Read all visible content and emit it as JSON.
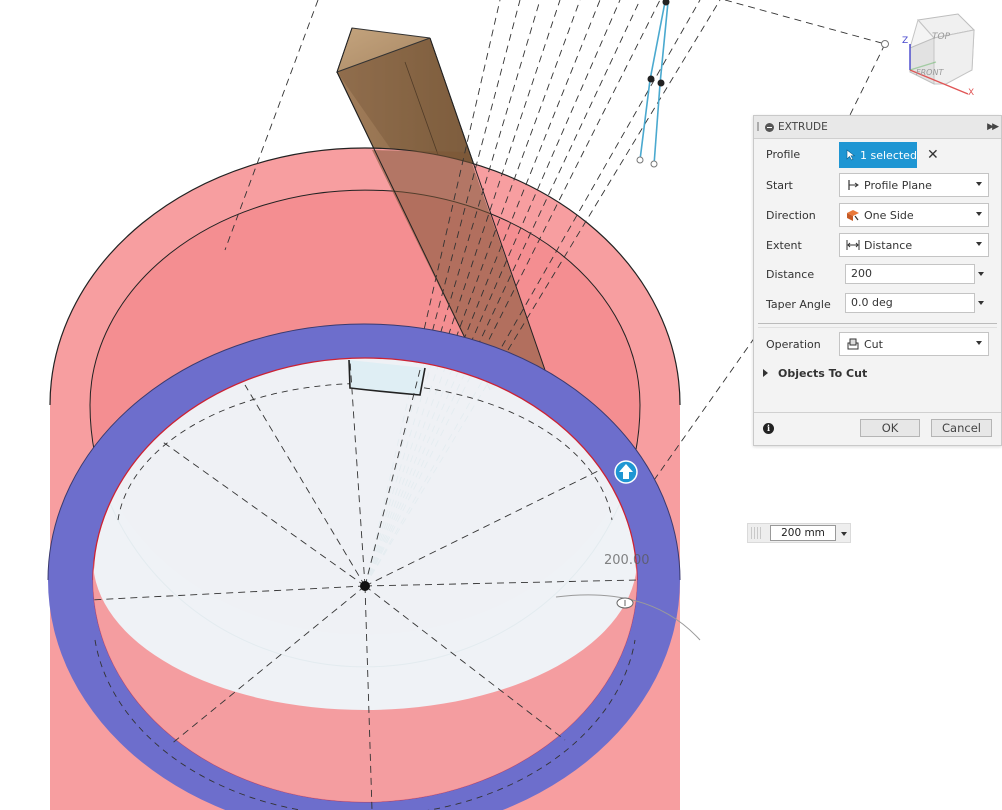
{
  "panel": {
    "title": "EXTRUDE",
    "profile_label": "Profile",
    "profile_value": "1 selected",
    "start_label": "Start",
    "start_value": "Profile Plane",
    "direction_label": "Direction",
    "direction_value": "One Side",
    "extent_label": "Extent",
    "extent_value": "Distance",
    "distance_label": "Distance",
    "distance_value": "200",
    "taper_label": "Taper Angle",
    "taper_value": "0.0 deg",
    "operation_label": "Operation",
    "operation_value": "Cut",
    "objects_to_cut": "Objects To Cut",
    "ok_label": "OK",
    "cancel_label": "Cancel",
    "accent_color": "#1f96d3"
  },
  "viewport": {
    "dimension_input": "200 mm",
    "dimension_label": "200.00",
    "body_color": "#f5878a",
    "face_color": "#6f6fcc",
    "profile_fill_color": "#eef7fb",
    "stock_color": "#8a6a4a"
  },
  "viewcube": {
    "top_label": "TOP",
    "front_label": "FRONT",
    "axis_x": "X",
    "axis_z": "Z"
  }
}
